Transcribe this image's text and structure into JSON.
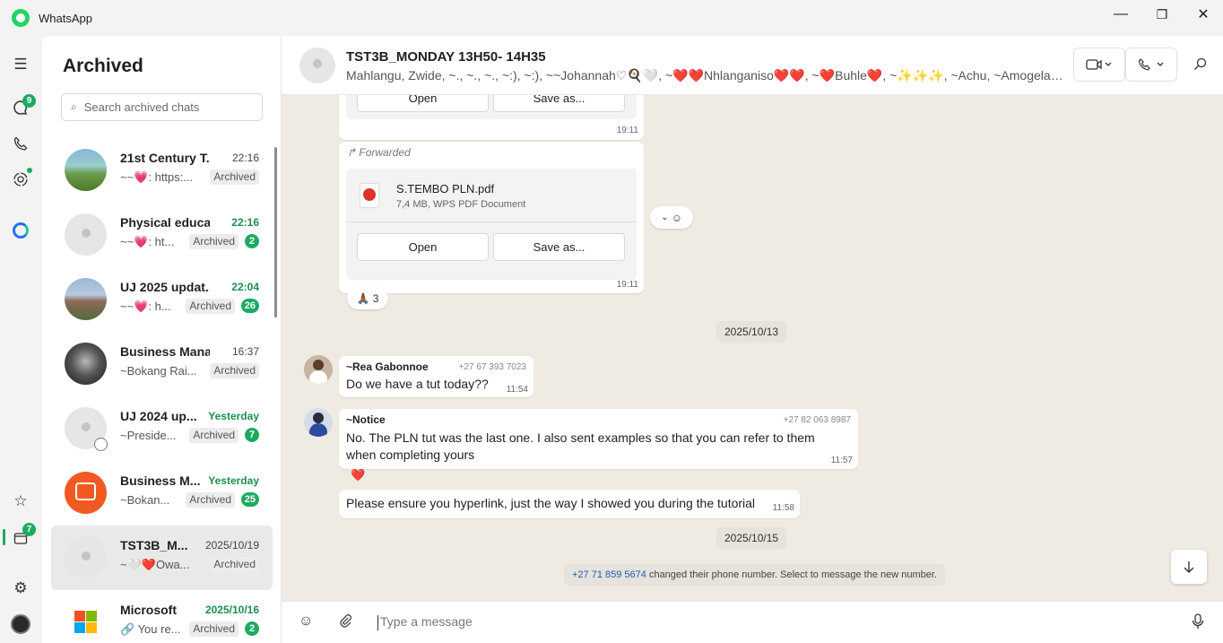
{
  "window": {
    "app_name": "WhatsApp",
    "minimize_icon": "—",
    "maximize_icon": "❐",
    "close_icon": "✕"
  },
  "rail": {
    "chats_badge": "9",
    "archived_badge": "7"
  },
  "archived": {
    "title": "Archived",
    "search_placeholder": "Search archived chats",
    "chats": [
      {
        "name": "21st Century T...",
        "time": "22:16",
        "time_green": false,
        "preview": "~~💗: https:...",
        "tag": "Archived",
        "unread": ""
      },
      {
        "name": "Physical educa...",
        "time": "22:16",
        "time_green": true,
        "preview": "~~💗: ht...",
        "tag": "Archived",
        "unread": "2"
      },
      {
        "name": "UJ 2025 updat...",
        "time": "22:04",
        "time_green": true,
        "preview": "~~💗: h...",
        "tag": "Archived",
        "unread": "26"
      },
      {
        "name": "Business Mana...",
        "time": "16:37",
        "time_green": false,
        "preview": "~Bokang Rai...",
        "tag": "Archived",
        "unread": ""
      },
      {
        "name": "UJ 2024 up...",
        "time": "Yesterday",
        "time_green": true,
        "preview": "~Preside...",
        "tag": "Archived",
        "unread": "7"
      },
      {
        "name": "Business M...",
        "time": "Yesterday",
        "time_green": true,
        "preview": "~Bokan...",
        "tag": "Archived",
        "unread": "25"
      },
      {
        "name": "TST3B_M...",
        "time": "2025/10/19",
        "time_green": false,
        "preview": "~🤍❤️Owa...",
        "tag": "Archived",
        "unread": ""
      },
      {
        "name": "Microsoft",
        "time": "2025/10/16",
        "time_green": true,
        "preview": "🔗 You re...",
        "tag": "Archived",
        "unread": "2"
      }
    ]
  },
  "conversation": {
    "group_name": "TST3B_MONDAY 13H50- 14H35",
    "members": "Mahlangu, Zwide, ~., ~., ~., ~:), ~:), ~~Johannah♡🍳🤍, ~❤️❤️Nhlanganiso❤️❤️, ~❤️Buhle❤️, ~✨✨✨, ~Achu, ~Amogelang,...",
    "top_doc": {
      "open_label": "Open",
      "save_label": "Save as...",
      "time": "19:11"
    },
    "forwarded_doc": {
      "forwarded_label": "Forwarded",
      "file_name": "S.TEMBO PLN.pdf",
      "file_meta": "7,4 MB, WPS PDF Document",
      "open_label": "Open",
      "save_label": "Save as...",
      "time": "19:11",
      "reaction_emoji": "🙏🏾",
      "reaction_count": "3"
    },
    "date1": "2025/10/13",
    "msg1": {
      "sender": "~Rea Gabonnoe",
      "phone": "+27 67 393 7023",
      "text": "Do we have a tut today??",
      "time": "11:54"
    },
    "msg2": {
      "sender": "~Notice",
      "phone": "+27 82 063 8987",
      "text": "No. The PLN tut was the last one. I also sent examples so that you can refer to them when completing yours",
      "time": "11:57",
      "reaction": "❤️"
    },
    "msg3": {
      "text": "Please ensure you hyperlink, just the way I showed you during the tutorial",
      "time": "11:58"
    },
    "date2": "2025/10/15",
    "system": {
      "phone": "+27 71 859 5674",
      "text": " changed their phone number. Select to message the new number."
    },
    "composer_placeholder": "Type a message"
  },
  "colors": {
    "accent": "#1daa61",
    "chat_bg": "#efeae2",
    "sender1": "#1f7a4a",
    "sender2": "#1a7ad9"
  }
}
